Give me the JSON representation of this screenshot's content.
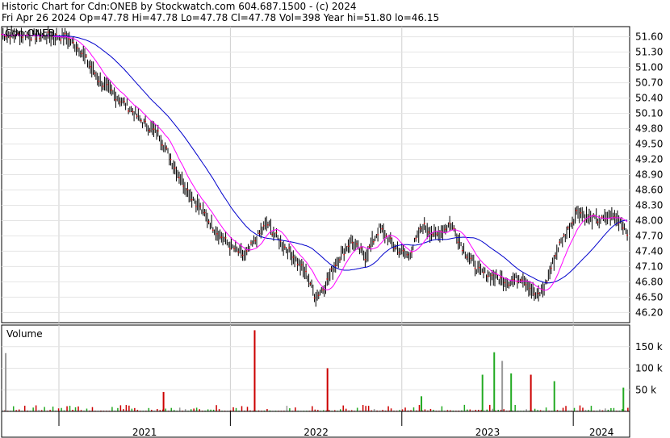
{
  "header": {
    "line1": "Historic Chart for Cdn:ONEB by Stockwatch.com 604.687.1500 - (c) 2024",
    "line2": "Fri Apr 26 2024  Op=47.78  Hi=47.78  Lo=47.78  Cl=47.78  Vol=398  Year hi=51.80  lo=46.15"
  },
  "chart_data": [
    {
      "type": "line",
      "legend": [
        "Cdn:ONEB"
      ],
      "ylim": [
        46.0,
        51.8
      ],
      "yticks": [
        46.2,
        46.5,
        46.8,
        47.1,
        47.4,
        47.7,
        48.0,
        48.3,
        48.6,
        48.9,
        49.2,
        49.5,
        49.8,
        50.1,
        50.4,
        50.7,
        51.0,
        51.3,
        51.6
      ],
      "ytick_labels": [
        "46.20",
        "46.50",
        "46.80",
        "47.10",
        "47.40",
        "47.70",
        "48.00",
        "48.30",
        "48.60",
        "48.90",
        "49.20",
        "49.50",
        "49.80",
        "50.10",
        "50.40",
        "50.70",
        "51.00",
        "51.30",
        "51.60"
      ],
      "xlim": [
        "2020-09-01",
        "2024-04-30"
      ],
      "x_labels": [
        "2021",
        "2022",
        "2023",
        "2024"
      ],
      "grid": true,
      "colors": {
        "price": "#000000",
        "close_dot": "#cc0000",
        "ma_short": "#ff00ff",
        "ma_long": "#0000cc"
      },
      "price_keypoints": [
        [
          "2020-09-01",
          51.65
        ],
        [
          "2020-11-15",
          51.62
        ],
        [
          "2021-01-15",
          51.6
        ],
        [
          "2021-02-15",
          51.35
        ],
        [
          "2021-03-10",
          51.0
        ],
        [
          "2021-04-01",
          50.7
        ],
        [
          "2021-05-01",
          50.45
        ],
        [
          "2021-06-01",
          50.2
        ],
        [
          "2021-07-01",
          49.9
        ],
        [
          "2021-08-01",
          49.7
        ],
        [
          "2021-09-01",
          49.1
        ],
        [
          "2021-10-01",
          48.6
        ],
        [
          "2021-11-01",
          48.2
        ],
        [
          "2021-12-01",
          47.8
        ],
        [
          "2022-01-01",
          47.5
        ],
        [
          "2022-02-01",
          47.3
        ],
        [
          "2022-03-01",
          47.7
        ],
        [
          "2022-03-20",
          47.95
        ],
        [
          "2022-04-15",
          47.6
        ],
        [
          "2022-05-15",
          47.3
        ],
        [
          "2022-06-15",
          46.9
        ],
        [
          "2022-07-01",
          46.5
        ],
        [
          "2022-07-20",
          46.7
        ],
        [
          "2022-08-15",
          47.2
        ],
        [
          "2022-09-15",
          47.6
        ],
        [
          "2022-10-15",
          47.3
        ],
        [
          "2022-11-15",
          47.85
        ],
        [
          "2022-12-15",
          47.5
        ],
        [
          "2023-01-15",
          47.3
        ],
        [
          "2023-02-15",
          47.9
        ],
        [
          "2023-03-15",
          47.7
        ],
        [
          "2023-04-15",
          47.95
        ],
        [
          "2023-05-15",
          47.4
        ],
        [
          "2023-06-15",
          47.0
        ],
        [
          "2023-07-15",
          46.9
        ],
        [
          "2023-08-15",
          46.8
        ],
        [
          "2023-09-15",
          46.9
        ],
        [
          "2023-10-15",
          46.5
        ],
        [
          "2023-11-01",
          46.7
        ],
        [
          "2023-12-01",
          47.5
        ],
        [
          "2023-12-20",
          47.8
        ],
        [
          "2024-01-10",
          48.2
        ],
        [
          "2024-02-01",
          48.05
        ],
        [
          "2024-03-01",
          48.0
        ],
        [
          "2024-03-20",
          48.1
        ],
        [
          "2024-04-10",
          48.0
        ],
        [
          "2024-04-26",
          47.78
        ]
      ]
    },
    {
      "type": "bar",
      "title": "Volume",
      "ylim": [
        0,
        200000
      ],
      "yticks": [
        50000,
        100000,
        150000
      ],
      "ytick_labels": [
        "50 k",
        "100 k",
        "150 k"
      ],
      "x_labels": [
        "2021",
        "2022",
        "2023",
        "2024"
      ],
      "colors": {
        "down": "#cc0000",
        "up": "#22aa22",
        "flat": "#999999"
      },
      "spikes": [
        [
          "2020-09-08",
          135000,
          "flat"
        ],
        [
          "2021-08-10",
          45000,
          "down"
        ],
        [
          "2022-02-20",
          188000,
          "down"
        ],
        [
          "2022-07-25",
          100000,
          "down"
        ],
        [
          "2023-02-10",
          35000,
          "up"
        ],
        [
          "2023-06-20",
          85000,
          "up"
        ],
        [
          "2023-07-15",
          137000,
          "up"
        ],
        [
          "2023-08-01",
          117000,
          "flat"
        ],
        [
          "2023-08-20",
          88000,
          "up"
        ],
        [
          "2023-10-01",
          85000,
          "down"
        ],
        [
          "2023-11-20",
          70000,
          "up"
        ],
        [
          "2024-04-15",
          55000,
          "up"
        ]
      ]
    }
  ]
}
